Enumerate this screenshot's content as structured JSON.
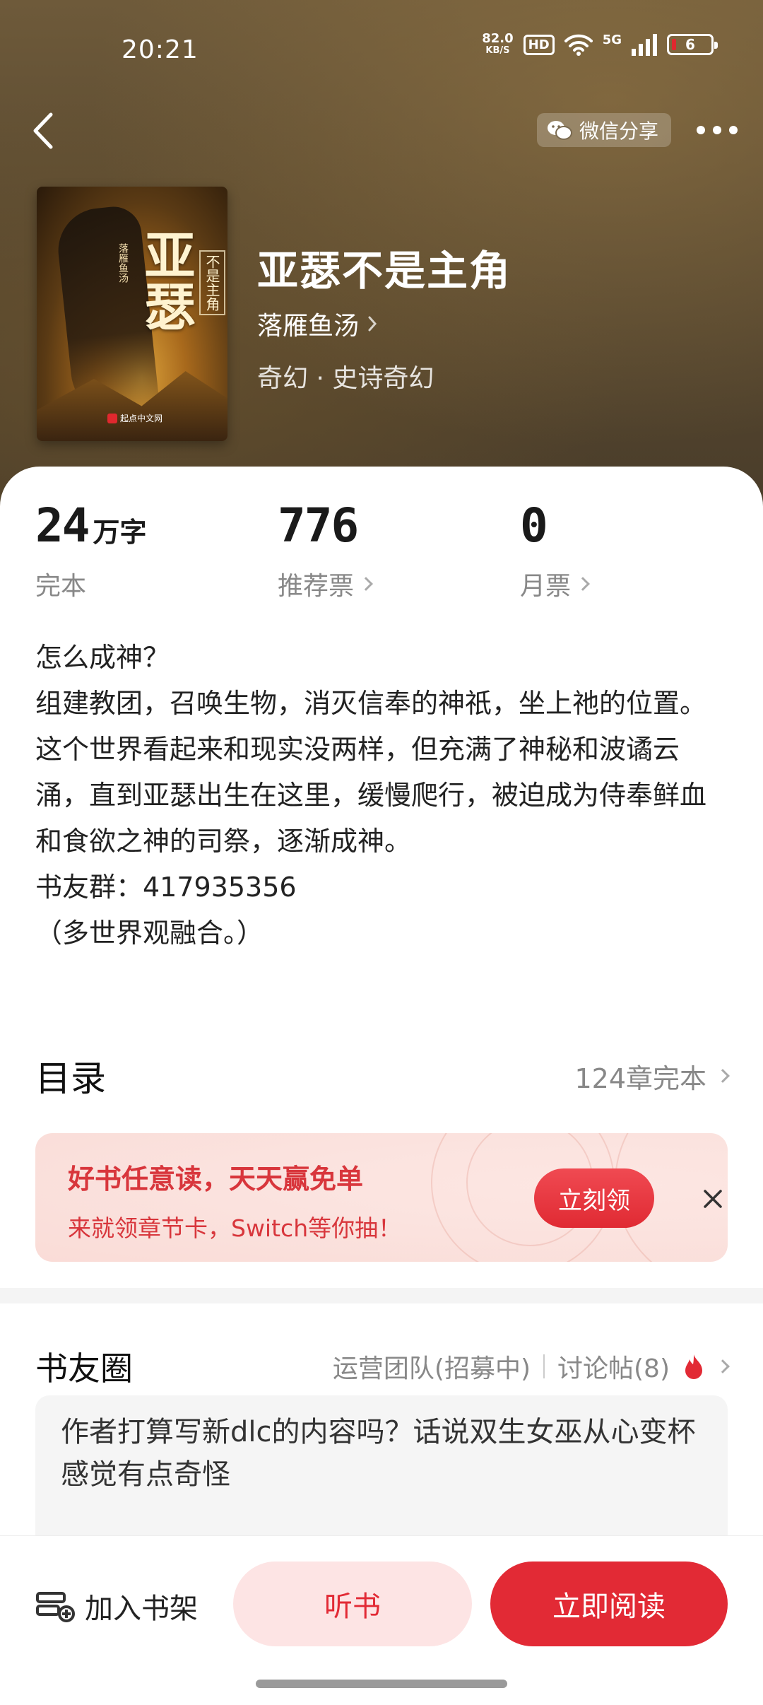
{
  "status_bar": {
    "time": "20:21",
    "net_speed_value": "82.0",
    "net_speed_unit": "KB/S",
    "hd": "HD",
    "network": "5G",
    "battery": "6"
  },
  "header": {
    "share_label": "微信分享"
  },
  "book": {
    "title": "亚瑟不是主角",
    "author": "落雁鱼汤",
    "genre": "奇幻 · 史诗奇幻",
    "cover": {
      "big_title": "亚瑟",
      "small_title": "不是主角",
      "author": "落雁鱼汤",
      "publisher": "起点中文网"
    }
  },
  "stats": {
    "words_num": "24",
    "words_unit": "万字",
    "words_label": "完本",
    "rec_num": "776",
    "rec_label": "推荐票",
    "monthly_num": "0",
    "monthly_label": "月票"
  },
  "synopsis": "怎么成神？\n组建教团，召唤生物，消灭信奉的神祇，坐上祂的位置。\n这个世界看起来和现实没两样，但充满了神秘和波谲云涌，直到亚瑟出生在这里，缓慢爬行，被迫成为侍奉鲜血和食欲之神的司祭，逐渐成神。\n书友群：417935356\n（多世界观融合。）",
  "toc": {
    "title": "目录",
    "info": "124章完本"
  },
  "promo": {
    "title": "好书任意读，天天赢免单",
    "subtitle": "来就领章节卡，Switch等你抽！",
    "button": "立刻领"
  },
  "community": {
    "title": "书友圈",
    "ops_team": "运营团队(招募中)",
    "posts": "讨论帖(8)",
    "post_preview": "作者打算写新dlc的内容吗？话说双生女巫从心变杯感觉有点奇怪"
  },
  "bottom_bar": {
    "shelf": "加入书架",
    "listen": "听书",
    "read": "立即阅读"
  },
  "colors": {
    "accent": "#e22a35",
    "accent_light": "#fde4e4",
    "muted": "#888888"
  }
}
